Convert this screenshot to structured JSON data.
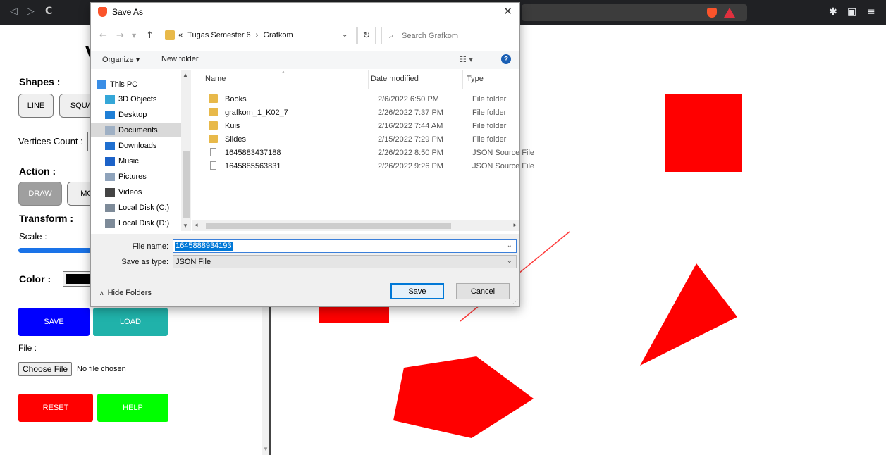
{
  "browser": {
    "nav": {
      "back": "◁",
      "forward": "▷",
      "reload": "C"
    }
  },
  "page": {
    "heading_partial": "V",
    "shapes": {
      "title": "Shapes :",
      "line": "LINE",
      "square_partial": "SQUA"
    },
    "vertices": {
      "label": "Vertices Count :"
    },
    "action": {
      "title": "Action :",
      "draw": "DRAW",
      "move_partial": "MO"
    },
    "transform": {
      "title": "Transform :",
      "scale_label": "Scale :"
    },
    "color": {
      "label": "Color :",
      "value": "#000000"
    },
    "buttons": {
      "save": "SAVE",
      "load": "LOAD",
      "reset": "RESET",
      "help": "HELP"
    },
    "file": {
      "label": "File :",
      "choose": "Choose File",
      "status": "No file chosen"
    }
  },
  "canvas": {
    "fill": "#ff0000",
    "line_color": "#ff3b3b"
  },
  "dialog": {
    "title": "Save As",
    "close": "✕",
    "address": {
      "prefix": "«",
      "crumbs": [
        "Tugas Semester 6",
        "Grafkom"
      ],
      "separator": "›"
    },
    "search_placeholder": "Search Grafkom",
    "toolbar": {
      "organize": "Organize ▾",
      "new_folder": "New folder",
      "view": "☷ ▾",
      "help": "?"
    },
    "nav_items": [
      {
        "label": "This PC",
        "icon": "pc-icon",
        "color": "#3a8ee6"
      },
      {
        "label": "3D Objects",
        "icon": "3d-objects-icon",
        "color": "#35a7d8"
      },
      {
        "label": "Desktop",
        "icon": "desktop-icon",
        "color": "#1f7fd6"
      },
      {
        "label": "Documents",
        "icon": "documents-icon",
        "color": "#9fb0c4",
        "selected": true
      },
      {
        "label": "Downloads",
        "icon": "downloads-icon",
        "color": "#1f6fd0"
      },
      {
        "label": "Music",
        "icon": "music-icon",
        "color": "#1c62c8"
      },
      {
        "label": "Pictures",
        "icon": "pictures-icon",
        "color": "#8fa3bb"
      },
      {
        "label": "Videos",
        "icon": "videos-icon",
        "color": "#444"
      },
      {
        "label": "Local Disk (C:)",
        "icon": "disk-c-icon",
        "color": "#7e8b99"
      },
      {
        "label": "Local Disk (D:)",
        "icon": "disk-d-icon",
        "color": "#7e8b99"
      }
    ],
    "columns": {
      "name": "Name",
      "date": "Date modified",
      "type": "Type"
    },
    "files": [
      {
        "name": "Books",
        "date": "2/6/2022 6:50 PM",
        "type": "File folder",
        "kind": "folder"
      },
      {
        "name": "grafkom_1_K02_7",
        "date": "2/26/2022 7:37 PM",
        "type": "File folder",
        "kind": "folder"
      },
      {
        "name": "Kuis",
        "date": "2/16/2022 7:44 AM",
        "type": "File folder",
        "kind": "folder"
      },
      {
        "name": "Slides",
        "date": "2/15/2022 7:29 PM",
        "type": "File folder",
        "kind": "folder"
      },
      {
        "name": "1645883437188",
        "date": "2/26/2022 8:50 PM",
        "type": "JSON Source File",
        "kind": "json"
      },
      {
        "name": "1645885563831",
        "date": "2/26/2022 9:26 PM",
        "type": "JSON Source File",
        "kind": "json"
      }
    ],
    "form": {
      "filename_label": "File name:",
      "filename_value": "1645888934193",
      "savetype_label": "Save as type:",
      "savetype_value": "JSON File"
    },
    "hide_folders": "Hide Folders",
    "save": "Save",
    "cancel": "Cancel"
  }
}
